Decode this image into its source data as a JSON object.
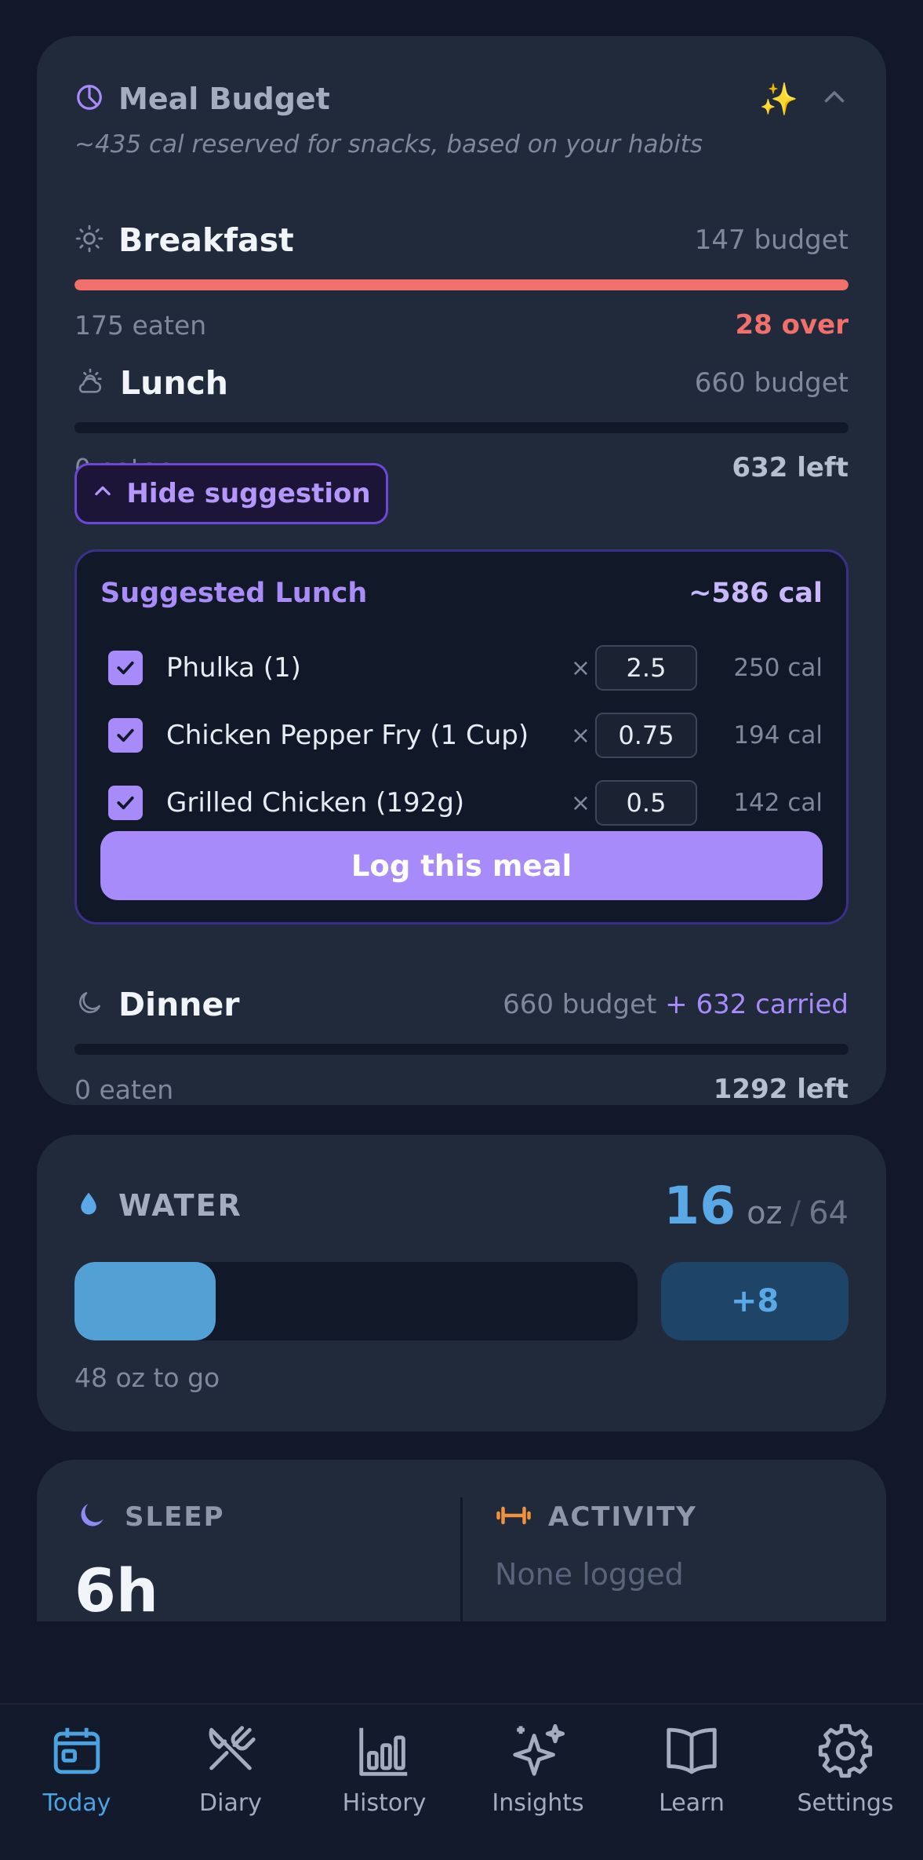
{
  "meal_budget": {
    "title": "Meal Budget",
    "subtitle": "~435 cal reserved for snacks, based on your habits",
    "meals": [
      {
        "name": "Breakfast",
        "budget": "147 budget",
        "eaten": "175 eaten",
        "status": "28 over",
        "progress": 1.0
      },
      {
        "name": "Lunch",
        "budget": "660 budget",
        "eaten": "0 eaten",
        "status": "632 left",
        "progress": 0
      },
      {
        "name": "Dinner",
        "budget": "660 budget",
        "carried": "+ 632 carried",
        "eaten": "0 eaten",
        "status": "1292 left",
        "progress": 0
      }
    ],
    "hide_suggestion_label": "Hide suggestion",
    "suggestion": {
      "title": "Suggested Lunch",
      "total": "~586 cal",
      "items": [
        {
          "name": "Phulka (1)",
          "qty": "2.5",
          "cal": "250 cal",
          "checked": true
        },
        {
          "name": "Chicken Pepper Fry (1 Cup)",
          "qty": "0.75",
          "cal": "194 cal",
          "checked": true
        },
        {
          "name": "Grilled Chicken (192g)",
          "qty": "0.5",
          "cal": "142 cal",
          "checked": true
        }
      ],
      "times_symbol": "×",
      "log_button": "Log this meal"
    }
  },
  "water": {
    "title": "WATER",
    "amount": "16",
    "unit": "oz",
    "separator": "/",
    "goal": "64",
    "progress": 0.25,
    "add_button": "+8",
    "remaining": "48 oz to go"
  },
  "sleep": {
    "title": "SLEEP",
    "value": "6h"
  },
  "activity": {
    "title": "ACTIVITY",
    "value": "None logged"
  },
  "nav": {
    "active": "Today",
    "tabs": [
      {
        "label": "Today",
        "icon": "calendar-icon"
      },
      {
        "label": "Diary",
        "icon": "fork-knife-icon"
      },
      {
        "label": "History",
        "icon": "bar-chart-icon"
      },
      {
        "label": "Insights",
        "icon": "sparkles-icon"
      },
      {
        "label": "Learn",
        "icon": "book-icon"
      },
      {
        "label": "Settings",
        "icon": "gear-icon"
      }
    ]
  },
  "colors": {
    "background": "#121829",
    "card": "#212a3b",
    "accent_purple": "#a78bfa",
    "over_red": "#f2706b",
    "water_blue": "#5aa9e6",
    "active_tab": "#4aa3e0"
  }
}
